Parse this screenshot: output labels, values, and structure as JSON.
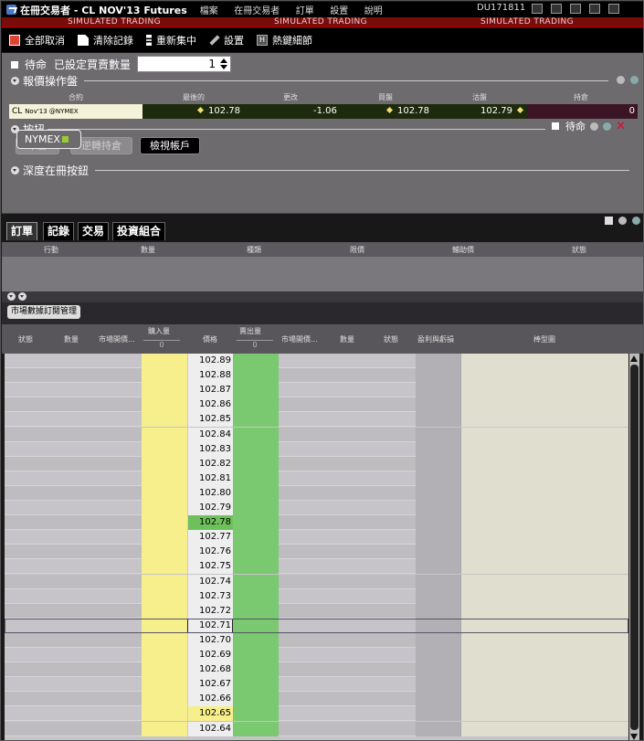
{
  "window": {
    "title": "在冊交易者 - CL NOV'13 Futures",
    "account": "DU171811"
  },
  "menu": [
    "檔案",
    "在冊交易者",
    "訂單",
    "設置",
    "說明"
  ],
  "banner": [
    "SIMULATED TRADING",
    "SIMULATED TRADING",
    "SIMULATED TRADING"
  ],
  "toolbar": {
    "cancel_all": "全部取消",
    "clear_log": "清除記錄",
    "recenter": "重新集中",
    "settings": "設置",
    "hotkeys": "熱鍵細節"
  },
  "order_panel": {
    "pending_label": "待命",
    "preset_qty_label": "已設定買賣數量",
    "qty_value": "1",
    "quote_section": "報價操作盤",
    "quote_headers": [
      "合約",
      "最後的",
      "更改",
      "買盤",
      "沽盤",
      "持倉"
    ],
    "quote": {
      "symbol": "CL",
      "contract": "Nov'13 @NYMEX",
      "last": "102.78",
      "change": "-1.06",
      "bid": "102.78",
      "ask": "102.79",
      "position": "0"
    },
    "buttons_section": "按扭",
    "btn_flatten": "平倉",
    "btn_reverse": "逆轉持倉",
    "btn_view_account": "檢視帳戶",
    "depth_section": "深度在冊按鈕",
    "exchange_btn": "NYMEX",
    "pending2_label": "待命"
  },
  "tabs": [
    "訂單",
    "記錄",
    "交易",
    "投資組合"
  ],
  "order_headers": [
    "行動",
    "數量",
    "種類",
    "限價",
    "輔助價",
    "狀態"
  ],
  "mdm_label": "市場數據訂閱管理",
  "depth_headers": {
    "status": "狀態",
    "qty": "數量",
    "mkt_depth": "市場開價...",
    "buy_qty": "購入量",
    "buy_sum": "0",
    "price": "價格",
    "sell_qty": "賣出量",
    "sell_sum": "0",
    "mkt_depth2": "市場開價...",
    "qty2": "數量",
    "status2": "狀態",
    "pnl": "盈利與虧損",
    "chart": "棒型圖"
  },
  "ladder": {
    "prices": [
      "102.89",
      "102.88",
      "102.87",
      "102.86",
      "102.85",
      "102.84",
      "102.83",
      "102.82",
      "102.81",
      "102.80",
      "102.79",
      "102.78",
      "102.77",
      "102.76",
      "102.75",
      "102.74",
      "102.73",
      "102.72",
      "102.71",
      "102.70",
      "102.69",
      "102.68",
      "102.67",
      "102.66",
      "102.65",
      "102.64"
    ],
    "last_price_index": 11,
    "highlight_buy_index": 24,
    "selected_index": 18
  },
  "colors": {
    "banner": "#7a0b0b",
    "buy": "#f7ef8c",
    "sell": "#7ac870",
    "last": "#6ec15a"
  }
}
